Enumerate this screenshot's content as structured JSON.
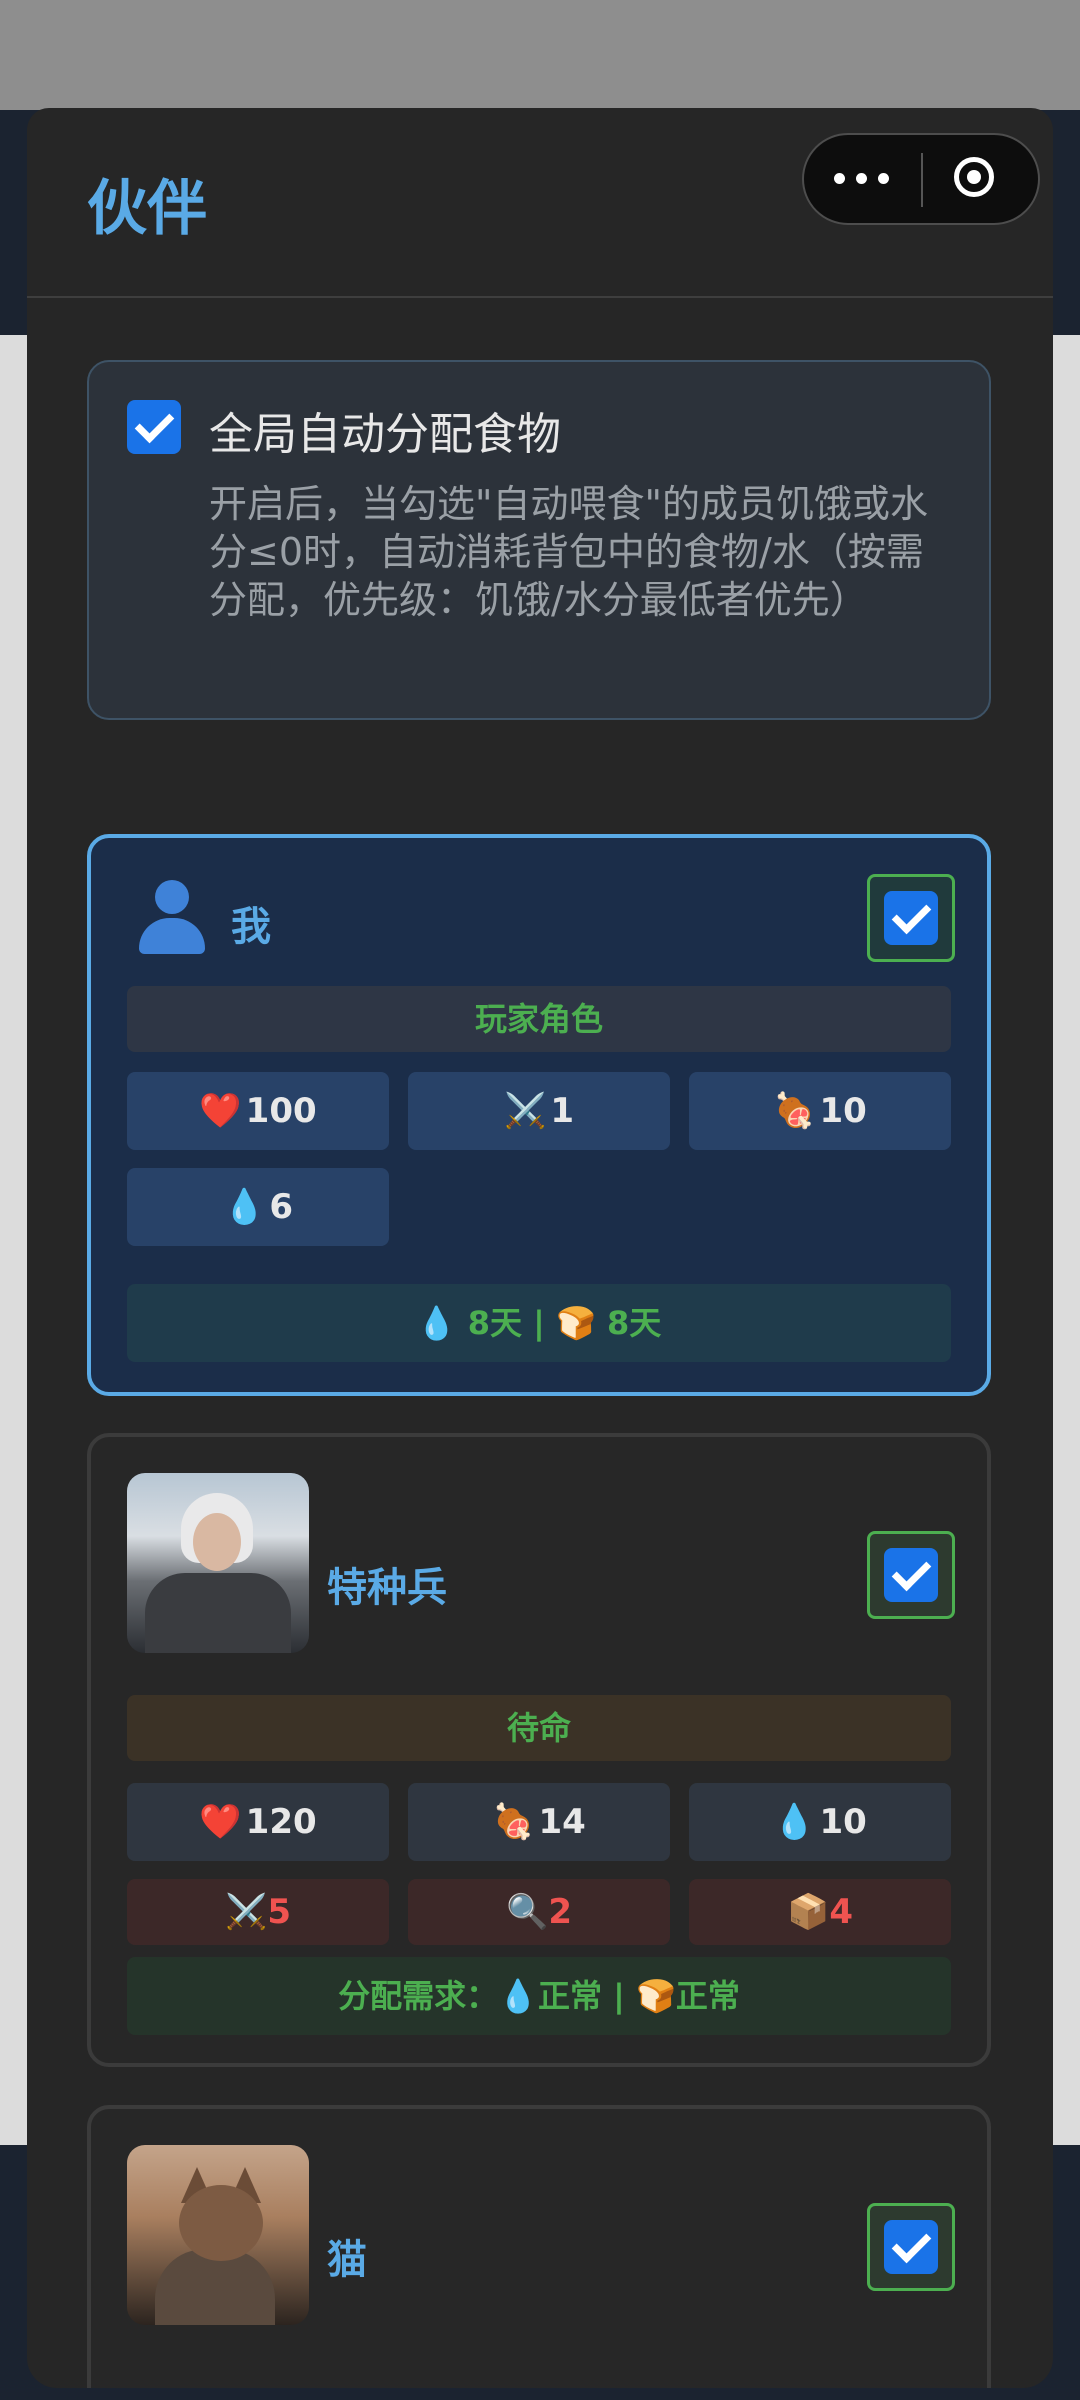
{
  "header": {
    "title": "伙伴",
    "close_glyph": "✖",
    "capsule": {
      "more_icon": "more-dots-icon",
      "target_icon": "target-icon"
    }
  },
  "global": {
    "checked": true,
    "title": "全局自动分配食物",
    "description": "开启后，当勾选\"自动喂食\"的成员饥饿或水分≤0时，自动消耗背包中的食物/水（按需分配，优先级：饥饿/水分最低者优先）"
  },
  "members": [
    {
      "name": "我",
      "avatar": "person-icon",
      "checked": true,
      "status": "玩家角色",
      "stats": [
        {
          "icon": "❤️",
          "value": "100"
        },
        {
          "icon": "⚔️",
          "value": "1"
        },
        {
          "icon": "🍖",
          "value": "10"
        },
        {
          "icon": "💧",
          "value": "6"
        }
      ],
      "footer": "💧 8天 | 🍞 8天"
    },
    {
      "name": "特种兵",
      "avatar": "soldier-portrait",
      "checked": true,
      "status": "待命",
      "stats": [
        {
          "icon": "❤️",
          "value": "120"
        },
        {
          "icon": "🍖",
          "value": "14"
        },
        {
          "icon": "💧",
          "value": "10"
        }
      ],
      "skills": [
        {
          "icon": "⚔️",
          "value": "5"
        },
        {
          "icon": "🔍",
          "value": "2"
        },
        {
          "icon": "📦",
          "value": "4"
        }
      ],
      "footer": "分配需求：💧正常 | 🍞正常"
    },
    {
      "name": "猫",
      "avatar": "cat-portrait",
      "checked": true
    }
  ],
  "colors": {
    "accent": "#5aaae6",
    "check": "#1a73e8",
    "green": "#4caf50",
    "red": "#ef5350"
  }
}
